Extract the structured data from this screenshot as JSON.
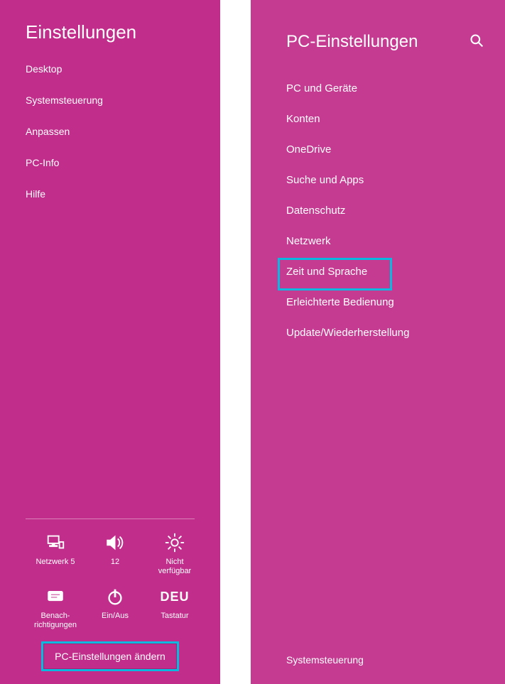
{
  "charm": {
    "title": "Einstellungen",
    "links": [
      "Desktop",
      "Systemsteuerung",
      "Anpassen",
      "PC-Info",
      "Hilfe"
    ],
    "tiles": [
      {
        "icon": "network-icon",
        "label": "Netzwerk  5"
      },
      {
        "icon": "volume-icon",
        "label": "12"
      },
      {
        "icon": "brightness-icon",
        "label": "Nicht\nverfügbar"
      },
      {
        "icon": "notify-icon",
        "label": "Benach-\nrichtigungen"
      },
      {
        "icon": "power-icon",
        "label": "Ein/Aus"
      },
      {
        "icon": "ime-text",
        "ime": "DEU",
        "label": "Tastatur"
      }
    ],
    "change_label": "PC-Einstellungen ändern"
  },
  "pc": {
    "title": "PC-Einstellungen",
    "items": [
      "PC und Geräte",
      "Konten",
      "OneDrive",
      "Suche und Apps",
      "Datenschutz",
      "Netzwerk",
      "Zeit und Sprache",
      "Erleichterte Bedienung",
      "Update/Wiederherstellung"
    ],
    "highlighted_index": 6,
    "footer": "Systemsteuerung"
  }
}
